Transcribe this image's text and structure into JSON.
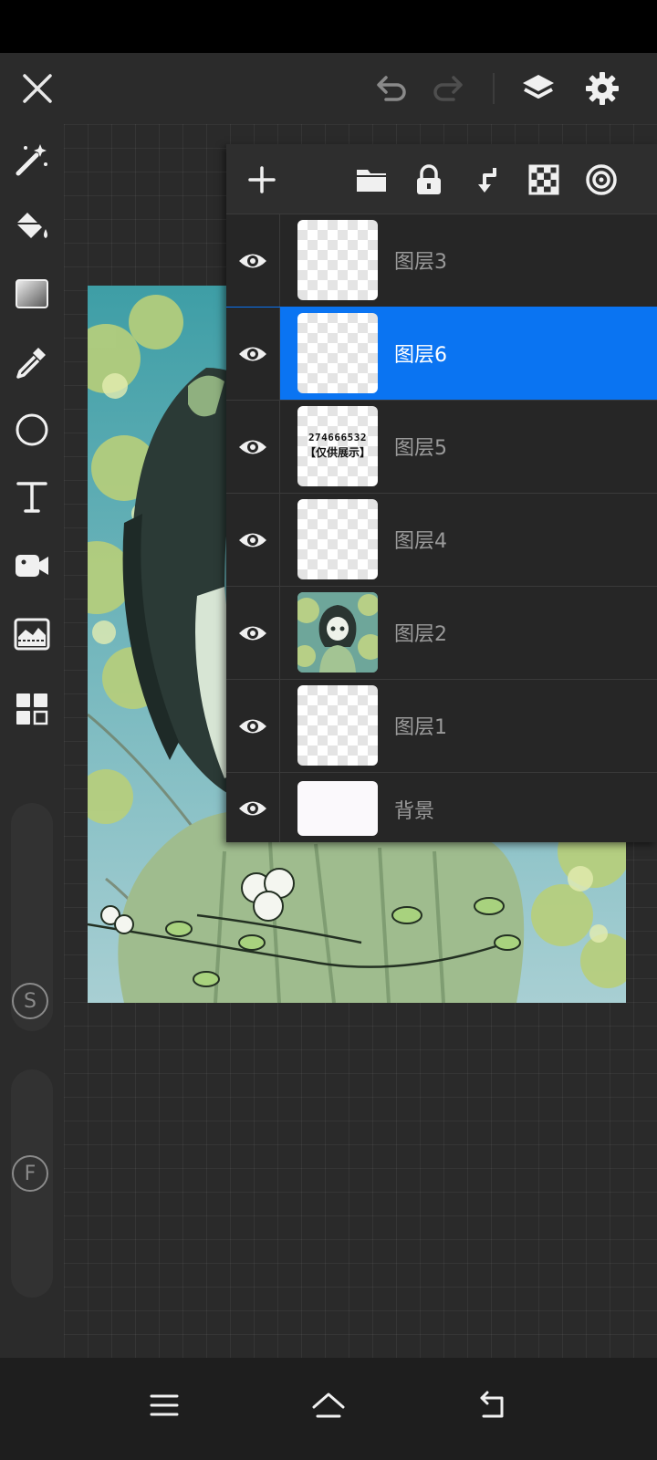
{
  "top_bar": {
    "icons": [
      "close-icon",
      "undo-icon",
      "redo-icon",
      "layers-icon",
      "settings-icon"
    ]
  },
  "left_toolbar": {
    "tools": [
      "magic-wand-icon",
      "paint-bucket-icon",
      "gradient-icon",
      "eyedropper-icon",
      "ellipse-icon",
      "text-icon",
      "video-icon",
      "image-adjust-icon",
      "grid-icon"
    ],
    "size_slider_label": "S",
    "flow_slider_label": "F"
  },
  "layers_panel": {
    "header_icons": [
      "add-icon",
      "folder-icon",
      "lock-icon",
      "merge-down-icon",
      "transparency-icon",
      "blend-target-icon"
    ],
    "layers": [
      {
        "name": "图层3",
        "visible": true,
        "selected": false,
        "thumb": "empty"
      },
      {
        "name": "图层6",
        "visible": true,
        "selected": true,
        "thumb": "empty"
      },
      {
        "name": "图层5",
        "visible": true,
        "selected": false,
        "thumb": "watermark"
      },
      {
        "name": "图层4",
        "visible": true,
        "selected": false,
        "thumb": "empty"
      },
      {
        "name": "图层2",
        "visible": true,
        "selected": false,
        "thumb": "artwork"
      },
      {
        "name": "图层1",
        "visible": true,
        "selected": false,
        "thumb": "empty"
      },
      {
        "name": "背景",
        "visible": true,
        "selected": false,
        "thumb": "white"
      }
    ],
    "watermark_text_line1": "274666532",
    "watermark_text_line2": "【仅供展示】"
  },
  "nav_bar": {
    "icons": [
      "menu-icon",
      "home-icon",
      "back-icon"
    ]
  },
  "colors": {
    "selection": "#0a74f2",
    "panel": "#262626",
    "background": "#262626"
  }
}
